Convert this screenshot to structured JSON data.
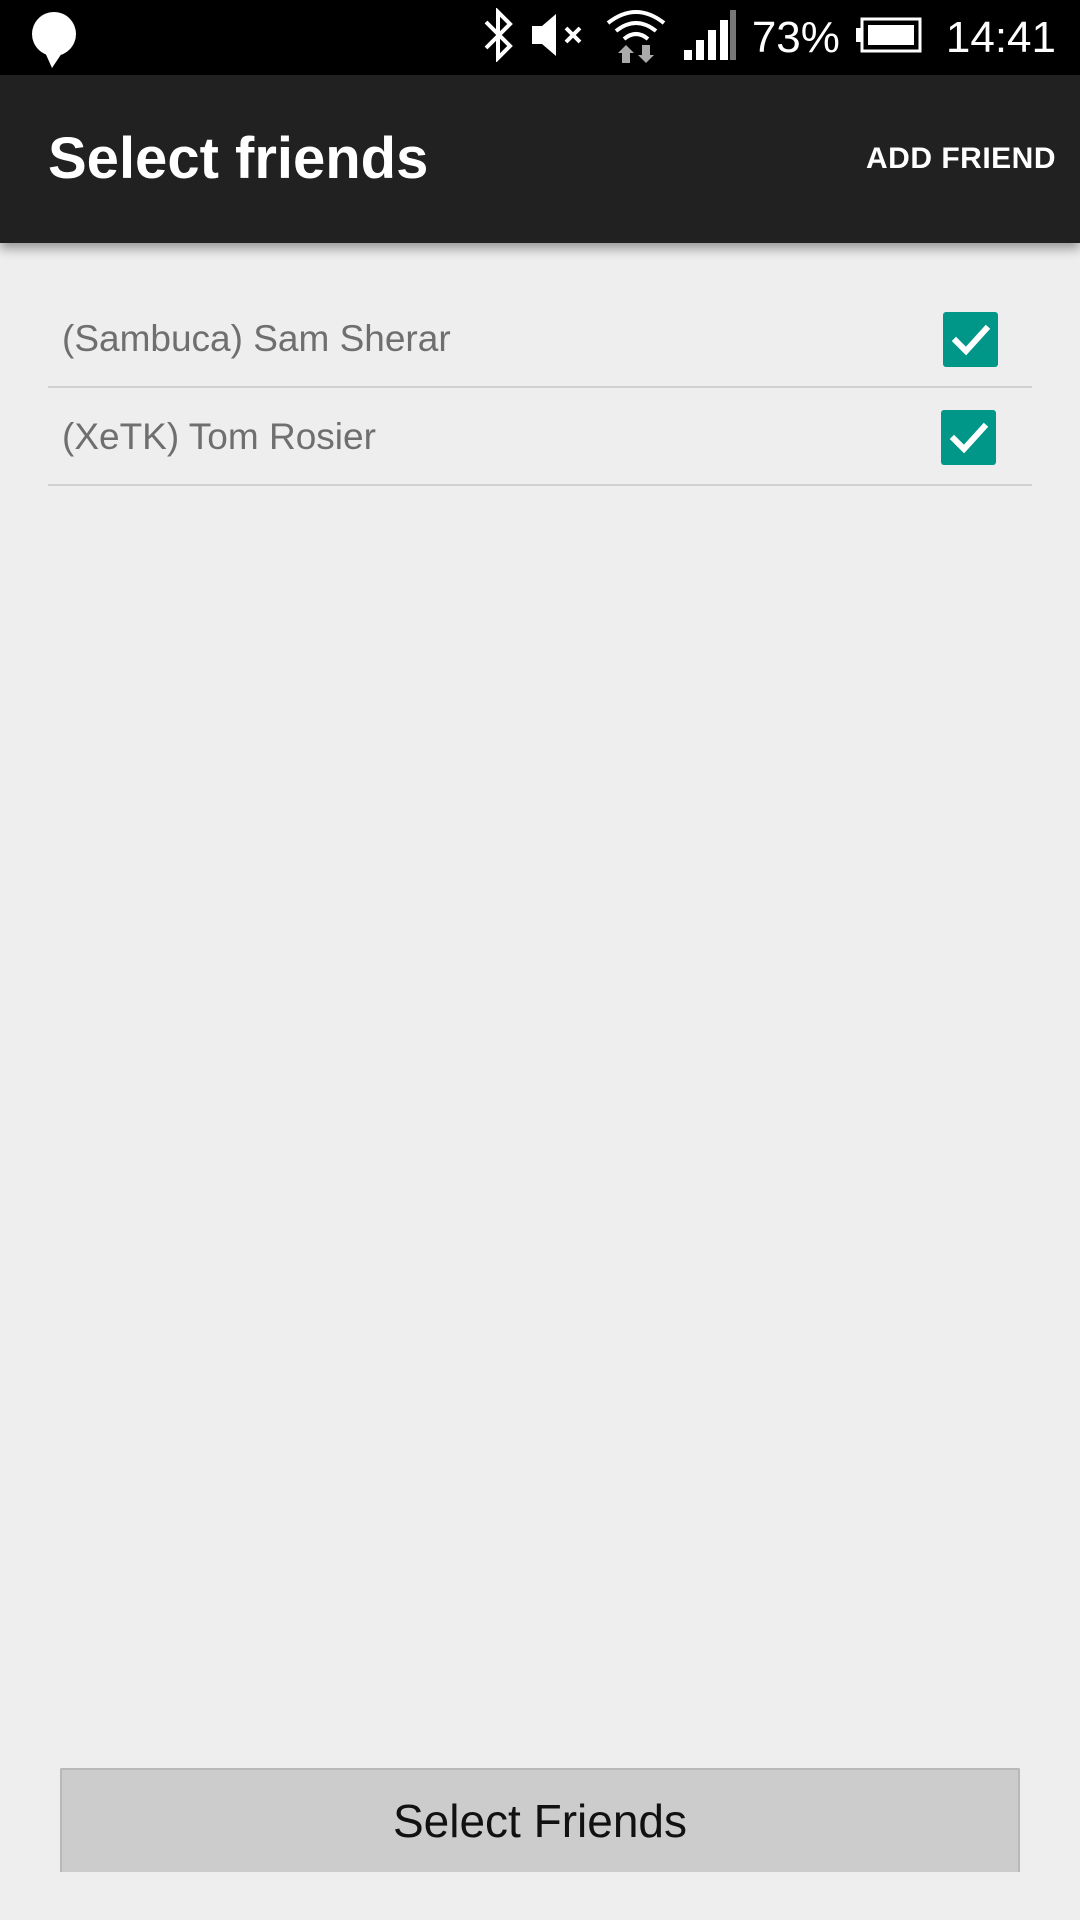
{
  "status_bar": {
    "battery_percent": "73%",
    "time": "14:41",
    "icons": [
      "pin-icon",
      "bluetooth-icon",
      "mute-icon",
      "wifi-icon",
      "signal-icon",
      "battery-icon"
    ]
  },
  "app_bar": {
    "title": "Select friends",
    "action_label": "ADD FRIEND"
  },
  "friends": [
    {
      "name": "(Sambuca) Sam Sherar",
      "checked": true
    },
    {
      "name": "(XeTK) Tom Rosier",
      "checked": true
    }
  ],
  "footer": {
    "button_label": "Select Friends"
  },
  "colors": {
    "checkbox": "#009688",
    "app_bar": "#212121",
    "background": "#eeeeee"
  }
}
